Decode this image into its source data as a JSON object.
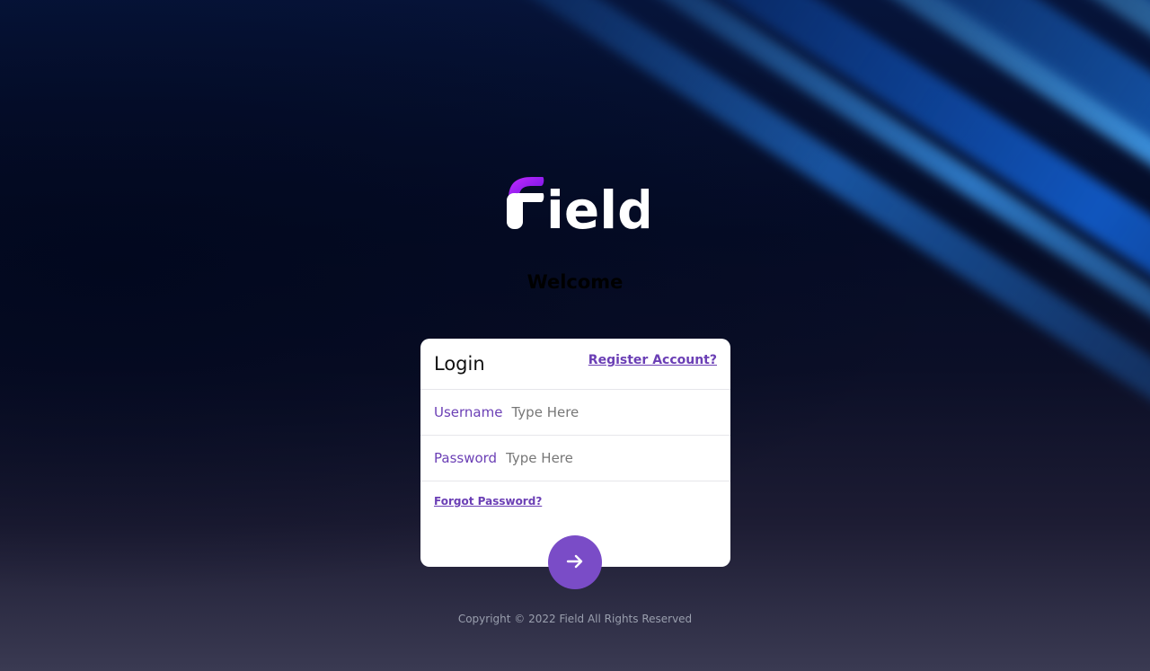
{
  "brand": {
    "name": "Field",
    "accent": "#7a4cc7",
    "logo_accent": "#9b1bff"
  },
  "welcome": "Welcome",
  "login": {
    "title": "Login",
    "register_label": "Register Account?",
    "username": {
      "label": "Username",
      "placeholder": "Type Here",
      "value": ""
    },
    "password": {
      "label": "Password",
      "placeholder": "Type Here",
      "value": ""
    },
    "forgot_label": "Forgot Password?",
    "submit_icon": "arrow-right-icon"
  },
  "footer": {
    "copyright": "Copyright © 2022 Field All Rights Reserved"
  }
}
